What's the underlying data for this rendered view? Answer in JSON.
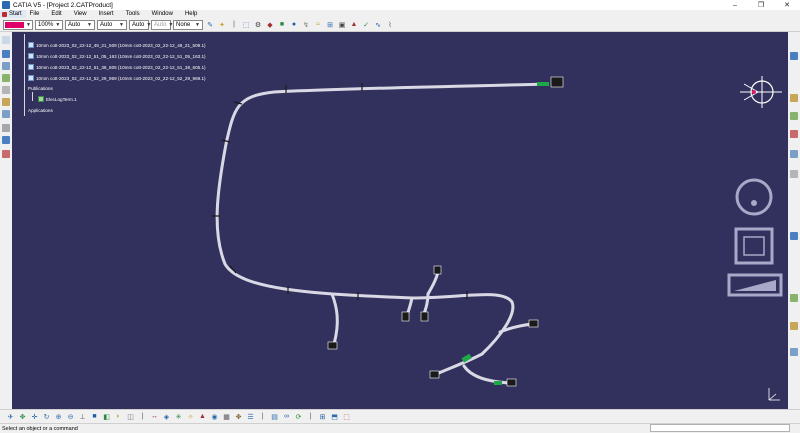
{
  "window": {
    "title": "CATIA V5 - [Project 2.CATProduct]",
    "minimize": "–",
    "restore": "❐",
    "close": "✕"
  },
  "menu": {
    "start": "Start",
    "items": [
      "File",
      "Edit",
      "View",
      "Insert",
      "Tools",
      "Window",
      "Help"
    ]
  },
  "toolbar": {
    "color": "#e0006a",
    "transparency": "100%",
    "line_thickness": "Auto",
    "line_type": "Auto",
    "point_type": "Auto",
    "layer_auto": "Auto",
    "layer": "None"
  },
  "tree": {
    "rows": [
      "10mm cott-2023_02_22-12_49_21_509 (10mm cott-2023_02_22-12_49_21_509.1)",
      "10mm cott-2023_02_22-12_51_05_163 (10mm cott-2023_02_22-12_51_05_163.1)",
      "10mm cott-2023_02_22-12_51_38_605 (10mm cott-2023_02_22-12_51_38_605.1)",
      "10mm cott-2023_02_22-12_52_29_969 (10mm cott-2023_02_22-12_52_29_969.1)"
    ],
    "publications": "Publications",
    "publication_item": "ElecLogTerm.1",
    "applications": "Applications"
  },
  "status": {
    "prompt": "Select an object or a command"
  },
  "colors": {
    "background": "#32305c",
    "harness": "#d9d9e6",
    "connector_green": "#1fa84a"
  }
}
